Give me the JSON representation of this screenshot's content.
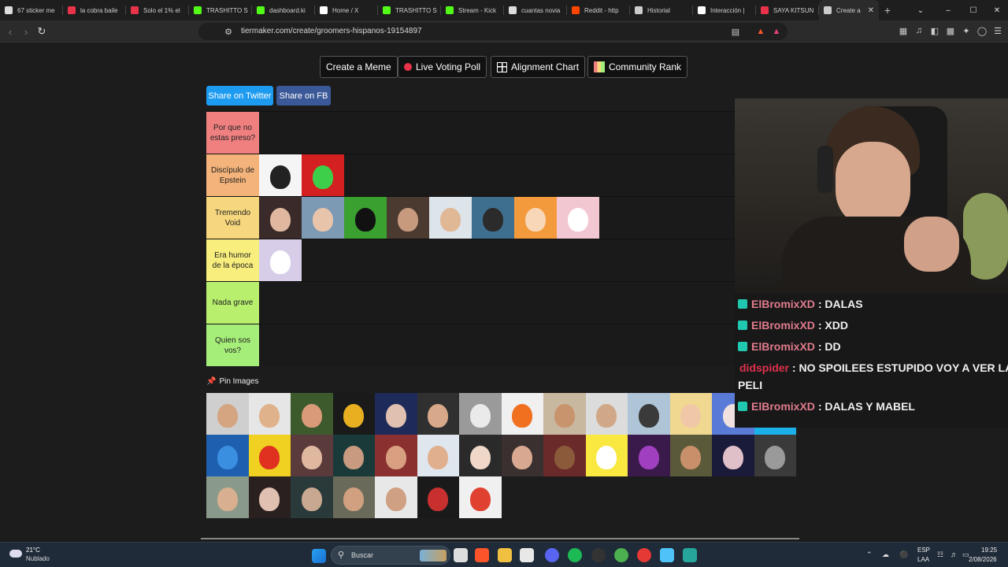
{
  "browser": {
    "tabs": [
      {
        "title": "67 sticker me",
        "icon_color": "#dddddd"
      },
      {
        "title": "la cobra baile",
        "icon_color": "#e8334a"
      },
      {
        "title": "Solo el 1% el",
        "icon_color": "#e8334a"
      },
      {
        "title": "TRASHITTO S",
        "icon_color": "#53fc18"
      },
      {
        "title": "dashboard.ki",
        "icon_color": "#53fc18"
      },
      {
        "title": "Home / X",
        "icon_color": "#ffffff"
      },
      {
        "title": "TRASHITTO S",
        "icon_color": "#53fc18"
      },
      {
        "title": "Stream - Kick",
        "icon_color": "#53fc18"
      },
      {
        "title": "cuantas novia",
        "icon_color": "#dddddd"
      },
      {
        "title": "Reddit - http",
        "icon_color": "#ff4500"
      },
      {
        "title": "Historial",
        "icon_color": "#cccccc"
      },
      {
        "title": "Interacción |",
        "icon_color": "#ffffff"
      },
      {
        "title": "SAYA KITSUN",
        "icon_color": "#e8334a"
      },
      {
        "title": "Create a",
        "icon_color": "#cccccc"
      }
    ],
    "url": "tiermaker.com/create/groomers-hispanos-19154897"
  },
  "page": {
    "top_buttons": {
      "create_meme": "Create a Meme",
      "live_voting": "Live Voting Poll",
      "alignment": "Alignment Chart",
      "community_rank": "Community Rank"
    },
    "share": {
      "twitter": "Share on Twitter",
      "fb": "Share on FB"
    },
    "tiers": [
      {
        "label": "Por que no estas preso?",
        "color": "#f08080",
        "items": []
      },
      {
        "label": "Discípulo de Epstein",
        "color": "#f4b37a",
        "items": [
          {
            "bg": "#f5f5f5",
            "face": "#222222"
          },
          {
            "bg": "#d42020",
            "face": "#3ecf4a"
          }
        ]
      },
      {
        "label": "Tremendo Void",
        "color": "#f6d77d",
        "items": [
          {
            "bg": "#3a2a2a",
            "face": "#e0b8a0"
          },
          {
            "bg": "#7d9ab5",
            "face": "#e8c4aa"
          },
          {
            "bg": "#3aa030",
            "face": "#111111"
          },
          {
            "bg": "#4a3a30",
            "face": "#c79a7e"
          },
          {
            "bg": "#dde4ea",
            "face": "#e0b896"
          },
          {
            "bg": "#3f6f8f",
            "face": "#2b2b2b"
          },
          {
            "bg": "#f39a3c",
            "face": "#f7d7b8"
          },
          {
            "bg": "#f2c7d1",
            "face": "#ffffff"
          }
        ]
      },
      {
        "label": "Era humor de la época",
        "color": "#f8ee7d",
        "items": [
          {
            "bg": "#d8cde8",
            "face": "#ffffff"
          }
        ]
      },
      {
        "label": "Nada grave",
        "color": "#b8f06e",
        "items": []
      },
      {
        "label": "Quien sos vos?",
        "color": "#a6ee7a",
        "items": []
      }
    ],
    "pin_label": "Pin Images",
    "pool": [
      {
        "bg": "#cfcfcf",
        "face": "#d5a582"
      },
      {
        "bg": "#e6e6e6",
        "face": "#e0b28c"
      },
      {
        "bg": "#3d5a2c",
        "face": "#d99a7a"
      },
      {
        "bg": "#1a1a1a",
        "face": "#e8b020"
      },
      {
        "bg": "#1e2a5a",
        "face": "#e0c0b0"
      },
      {
        "bg": "#303030",
        "face": "#d8a88a"
      },
      {
        "bg": "#9a9a9a",
        "face": "#eaeaea"
      },
      {
        "bg": "#f0f0f0",
        "face": "#f07020"
      },
      {
        "bg": "#c9b8a0",
        "face": "#c8946e"
      },
      {
        "bg": "#dcdcdc",
        "face": "#d0a888"
      },
      {
        "bg": "#b0c4d8",
        "face": "#3a3a3a"
      },
      {
        "bg": "#f0d890",
        "face": "#f0c8a8"
      },
      {
        "bg": "#5a7ad8",
        "face": "#f0e0e0"
      },
      {
        "bg": "#1ab0e8",
        "face": "#ffffff"
      },
      {
        "bg": "#1f5fb0",
        "face": "#3a8fe0"
      },
      {
        "bg": "#f0d020",
        "face": "#e03020"
      },
      {
        "bg": "#5a3a3a",
        "face": "#e0b8a0"
      },
      {
        "bg": "#1a3a3a",
        "face": "#c89a80"
      },
      {
        "bg": "#8a3030",
        "face": "#d8a080"
      },
      {
        "bg": "#dfe6ee",
        "face": "#e0b08e"
      },
      {
        "bg": "#2a2a2a",
        "face": "#f0d8c8"
      },
      {
        "bg": "#3a3030",
        "face": "#d8a890"
      },
      {
        "bg": "#6a2a2a",
        "face": "#8a5a3a"
      },
      {
        "bg": "#f8e840",
        "face": "#ffffff"
      },
      {
        "bg": "#3a1a4a",
        "face": "#a040c0"
      },
      {
        "bg": "#5a5a3a",
        "face": "#c8906a"
      },
      {
        "bg": "#1a1a3a",
        "face": "#e0c0c8"
      },
      {
        "bg": "#3a3a3a",
        "face": "#9a9a9a"
      },
      {
        "bg": "#8a9a8a",
        "face": "#d8b090"
      },
      {
        "bg": "#2a2020",
        "face": "#e0c0b0"
      },
      {
        "bg": "#2a3a3a",
        "face": "#c8a890"
      },
      {
        "bg": "#6a6a5a",
        "face": "#d0a080"
      },
      {
        "bg": "#e8e8e8",
        "face": "#d0a082"
      },
      {
        "bg": "#1a1a1a",
        "face": "#c83030"
      },
      {
        "bg": "#f0f0f0",
        "face": "#e04030"
      }
    ]
  },
  "chat": [
    {
      "user": "ElBromixXD",
      "text": ": DALAS"
    },
    {
      "user": "ElBromixXD",
      "text": ": XDD"
    },
    {
      "user": "ElBromixXD",
      "text": ": DD"
    },
    {
      "user": "didspider",
      "text": ": NO SPOILEES ESTUPIDO VOY A VER LA",
      "text2": "PELI"
    },
    {
      "user": "ElBromixXD",
      "text": ": DALAS Y MABEL"
    }
  ],
  "taskbar": {
    "weather_temp": "21°C",
    "weather_desc": "Nublado",
    "search_placeholder": "Buscar",
    "lang_top": "ESP",
    "lang_bottom": "LAA",
    "time": "19:25",
    "date": "2/08/2026"
  }
}
